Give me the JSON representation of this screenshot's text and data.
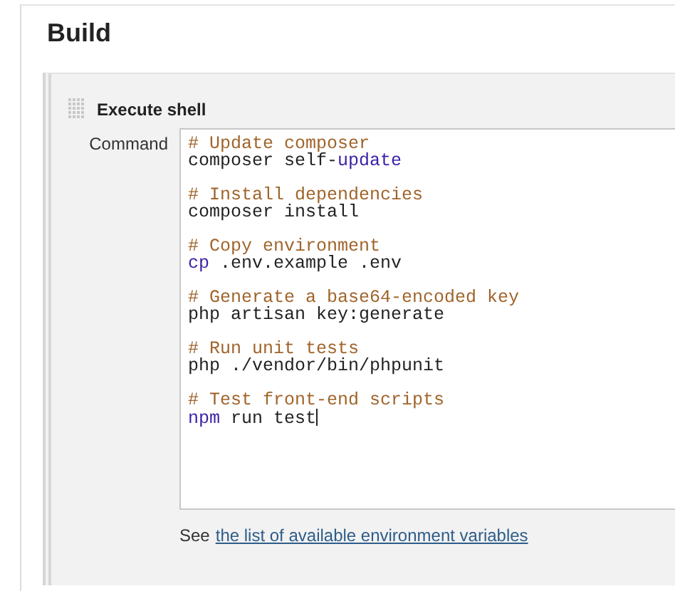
{
  "section": {
    "title": "Build"
  },
  "step": {
    "title": "Execute shell",
    "command_label": "Command",
    "script_groups": [
      [
        [
          {
            "kind": "comment",
            "text": "# Update composer"
          }
        ],
        [
          {
            "kind": "plain",
            "text": "composer self-"
          },
          {
            "kind": "keyword",
            "text": "update"
          }
        ]
      ],
      [
        [
          {
            "kind": "comment",
            "text": "# Install dependencies"
          }
        ],
        [
          {
            "kind": "plain",
            "text": "composer install"
          }
        ]
      ],
      [
        [
          {
            "kind": "comment",
            "text": "# Copy environment"
          }
        ],
        [
          {
            "kind": "keyword",
            "text": "cp"
          },
          {
            "kind": "plain",
            "text": " .env.example .env"
          }
        ]
      ],
      [
        [
          {
            "kind": "comment",
            "text": "# Generate a base64-encoded key"
          }
        ],
        [
          {
            "kind": "plain",
            "text": "php artisan key:generate"
          }
        ]
      ],
      [
        [
          {
            "kind": "comment",
            "text": "# Run unit tests"
          }
        ],
        [
          {
            "kind": "plain",
            "text": "php ./vendor/bin/phpunit"
          }
        ]
      ],
      [
        [
          {
            "kind": "comment",
            "text": "# Test front-end scripts"
          }
        ],
        [
          {
            "kind": "keyword",
            "text": "npm"
          },
          {
            "kind": "plain",
            "text": " run test"
          }
        ]
      ]
    ],
    "help_prefix": "See",
    "help_link": "the list of available environment variables"
  }
}
